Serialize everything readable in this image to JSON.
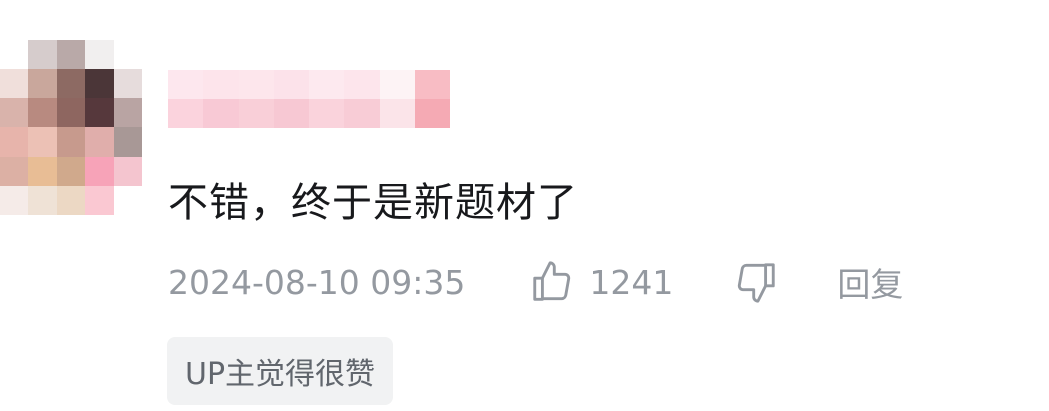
{
  "comment": {
    "text": "不错，终于是新题材了",
    "timestamp": "2024-08-10 09:35",
    "like_count": "1241",
    "reply_label": "回复",
    "badge": "UP主觉得很赞"
  },
  "icons": {
    "like": "thumb-up-icon",
    "dislike": "thumb-down-icon"
  },
  "colors": {
    "text_primary": "#18191c",
    "text_secondary": "#9499a0",
    "badge_bg": "#f1f2f3",
    "badge_text": "#61666d"
  }
}
